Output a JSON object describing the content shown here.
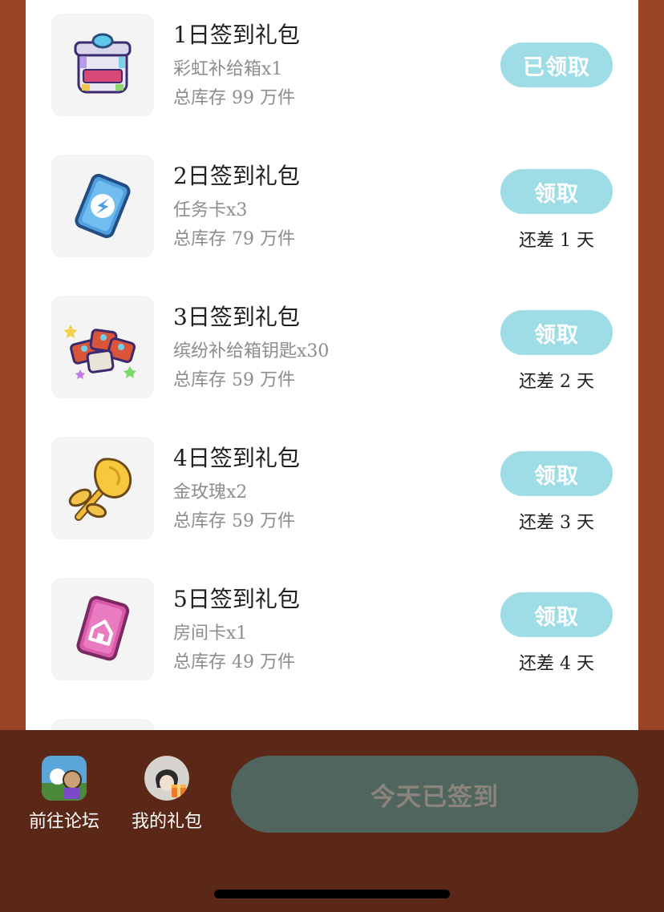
{
  "gifts": [
    {
      "title": "1日签到礼包",
      "item": "彩虹补给箱x1",
      "stock": "总库存 99 万件",
      "button": "已领取",
      "remaining": "",
      "icon": "rainbow-supply-box-icon"
    },
    {
      "title": "2日签到礼包",
      "item": "任务卡x3",
      "stock": "总库存 79 万件",
      "button": "领取",
      "remaining": "还差 1 天",
      "icon": "task-card-icon"
    },
    {
      "title": "3日签到礼包",
      "item": "缤纷补给箱钥匙x30",
      "stock": "总库存 59 万件",
      "button": "领取",
      "remaining": "还差 2 天",
      "icon": "supply-box-keys-icon"
    },
    {
      "title": "4日签到礼包",
      "item": "金玫瑰x2",
      "stock": "总库存 59 万件",
      "button": "领取",
      "remaining": "还差 3 天",
      "icon": "gold-rose-icon"
    },
    {
      "title": "5日签到礼包",
      "item": "房间卡x1",
      "stock": "总库存 49 万件",
      "button": "领取",
      "remaining": "还差 4 天",
      "icon": "room-card-icon"
    }
  ],
  "bottom_bar": {
    "forum_label": "前往论坛",
    "my_gifts_label": "我的礼包",
    "signin_label": "今天已签到"
  },
  "colors": {
    "page_bg": "#9a4226",
    "bottom_bar_bg": "#5b2818",
    "claim_button": "#9fdde6",
    "signin_button": "#4f655e",
    "signin_text": "#8b847c"
  }
}
